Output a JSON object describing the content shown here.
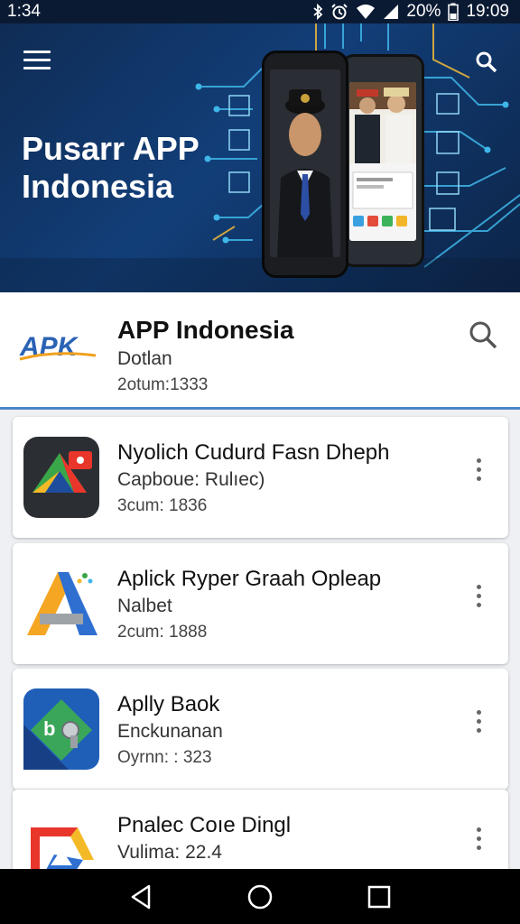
{
  "status_bar": {
    "left_time": "1:34",
    "battery": "20%",
    "time": "19:09",
    "icons": [
      "bluetooth-icon",
      "alarm-icon",
      "wifi-icon",
      "signal-icon",
      "battery-icon"
    ]
  },
  "hero": {
    "title_line1": "Pusarr APP",
    "title_line2": "Indonesia",
    "icons": [
      "menu-icon",
      "search-icon"
    ]
  },
  "featured": {
    "logo_text": "APK",
    "name": "APP Indonesia",
    "subtitle": "Dotlan",
    "meta": "2otum:1333"
  },
  "apps": [
    {
      "name": "Nyolich Cudurd Fasn Dheph",
      "subtitle": "Capboue: Rulıec)",
      "meta": "3cum: 1836",
      "icon": "gallery-app-icon"
    },
    {
      "name": "Aplick Ryper Graah Opleap",
      "subtitle": "Nalbet",
      "meta": "2cum: 1888",
      "icon": "a-logo-app-icon"
    },
    {
      "name": "Aplly Baok",
      "subtitle": "Enckunanan",
      "meta": "Oyrnn: : 323",
      "icon": "puzzle-app-icon"
    },
    {
      "name": "Pnalec Coıe Dingl",
      "subtitle": "Vulima: 22.4",
      "meta": "",
      "icon": "drive-app-icon"
    }
  ],
  "colors": {
    "hero_bg": "#123e78",
    "accent": "#4a86c8",
    "circuit": "#3fb6e8",
    "circuit_gold": "#e3b13d"
  },
  "nav": [
    "back-icon",
    "home-icon",
    "recents-icon"
  ]
}
